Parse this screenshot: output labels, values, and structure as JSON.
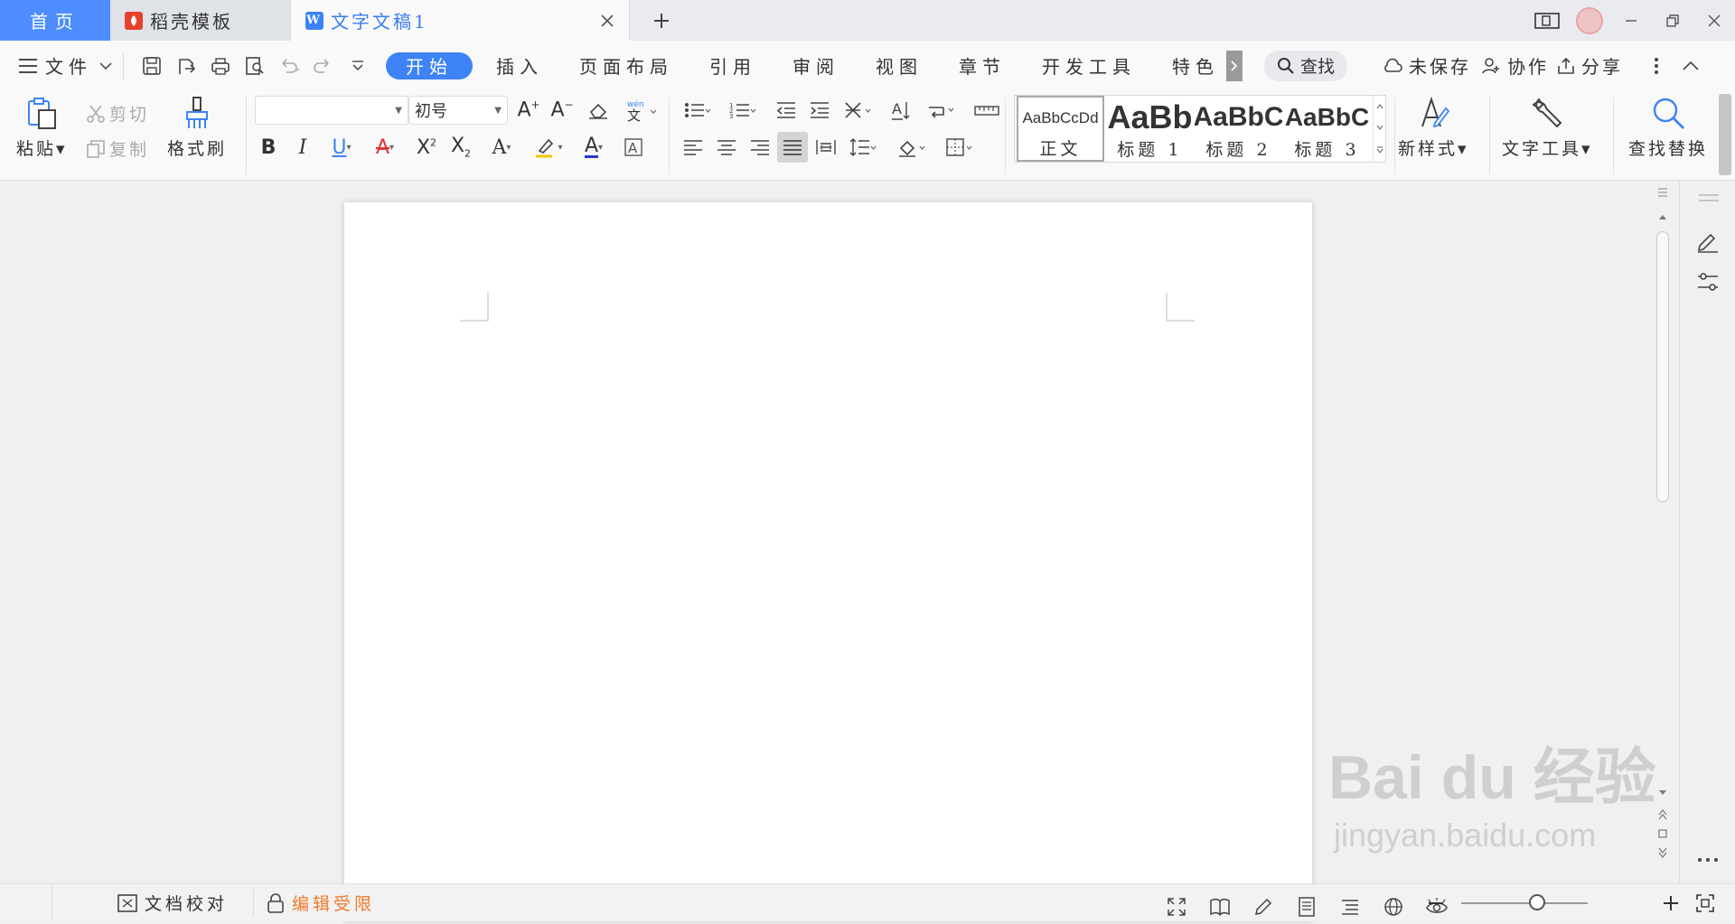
{
  "tabs": {
    "home": "首页",
    "template": "稻壳模板",
    "document": "文字文稿1"
  },
  "menu": {
    "file": "文件",
    "ribbon_tabs": [
      "开始",
      "插入",
      "页面布局",
      "引用",
      "审阅",
      "视图",
      "章节",
      "开发工具",
      "特色"
    ],
    "active_tab": "开始",
    "search": "查找",
    "unsaved": "未保存",
    "collab": "协作",
    "share": "分享"
  },
  "toolbar": {
    "paste": "粘贴",
    "cut": "剪切",
    "copy": "复制",
    "format_painter": "格式刷",
    "font_name": "",
    "font_size": "初号",
    "new_style": "新样式",
    "text_tools": "文字工具",
    "find_replace": "查找替换"
  },
  "styles": [
    {
      "sample": "AaBbCcDd",
      "name": "正文"
    },
    {
      "sample": "AaBb",
      "name": "标题 1"
    },
    {
      "sample": "AaBbC",
      "name": "标题 2"
    },
    {
      "sample": "AaBbC",
      "name": "标题 3"
    }
  ],
  "status": {
    "proofread": "文档校对",
    "edit_restrict": "编辑受限"
  },
  "zoom": 0.6,
  "watermark": {
    "brand": "Bai du 经验",
    "url": "jingyan.baidu.com"
  },
  "colors": {
    "accent": "#3e83f5",
    "home_tab": "#4d8dff",
    "restrict": "#f07a2a"
  }
}
